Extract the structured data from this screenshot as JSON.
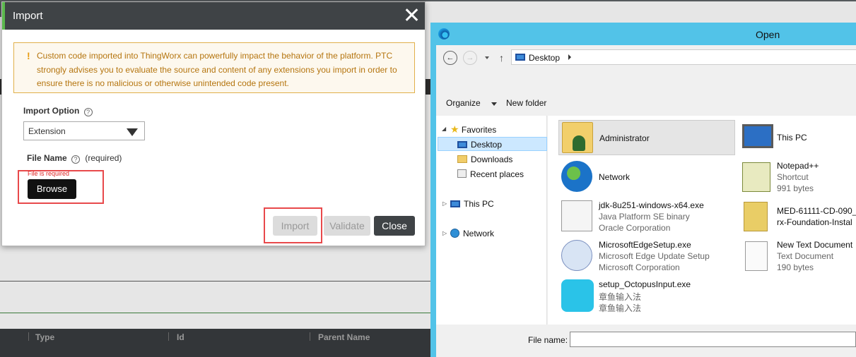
{
  "background_app": {
    "table_columns": [
      "Type",
      "Id",
      "Parent Name"
    ]
  },
  "import_dialog": {
    "title": "Import",
    "warning_icon": "!",
    "warning_text": "Custom code imported into ThingWorx can powerfully impact the behavior of the platform. PTC strongly advises you to evaluate the source and content of any extensions you import in order to ensure there is no malicious or otherwise unintended code present.",
    "import_option_label": "Import Option",
    "import_option_value": "Extension",
    "file_name_label": "File Name",
    "file_name_required": "(required)",
    "help_glyph": "?",
    "file_required_error": "File is required",
    "browse_label": "Browse",
    "import_label": "Import",
    "validate_label": "Validate",
    "close_label": "Close",
    "colors": {
      "accent": "#5bb94d",
      "header": "#3f4346",
      "warning": "#b5750f",
      "highlight": "#e8494b"
    }
  },
  "open_dialog": {
    "title": "Open",
    "address": "Desktop",
    "organize_label": "Organize",
    "new_folder_label": "New folder",
    "nav": {
      "favorites": "Favorites",
      "desktop": "Desktop",
      "downloads": "Downloads",
      "recent_places": "Recent places",
      "this_pc": "This PC",
      "network": "Network"
    },
    "files": [
      {
        "name": "Administrator",
        "line2": "",
        "line3": "",
        "icon": "user-folder-icon"
      },
      {
        "name": "This PC",
        "line2": "",
        "line3": "",
        "icon": "computer-icon"
      },
      {
        "name": "Network",
        "line2": "",
        "line3": "",
        "icon": "network-icon"
      },
      {
        "name": "Notepad++",
        "line2": "Shortcut",
        "line3": "991 bytes",
        "icon": "notepad-icon"
      },
      {
        "name": "jdk-8u251-windows-x64.exe",
        "line2": "Java Platform SE binary",
        "line3": "Oracle Corporation",
        "icon": "java-icon"
      },
      {
        "name": "MED-61111-CD-090_",
        "line2": "rx-Foundation-Instal",
        "line3": "",
        "icon": "zip-icon"
      },
      {
        "name": "MicrosoftEdgeSetup.exe",
        "line2": "Microsoft Edge Update Setup",
        "line3": "Microsoft Corporation",
        "icon": "setup-icon"
      },
      {
        "name": "New Text Document",
        "line2": "Text Document",
        "line3": "190 bytes",
        "icon": "text-file-icon"
      },
      {
        "name": "setup_OctopusInput.exe",
        "line2": "章鱼输入法",
        "line3": "章鱼输入法",
        "icon": "octopus-icon"
      }
    ],
    "file_name_label": "File name:",
    "file_name_value": ""
  }
}
